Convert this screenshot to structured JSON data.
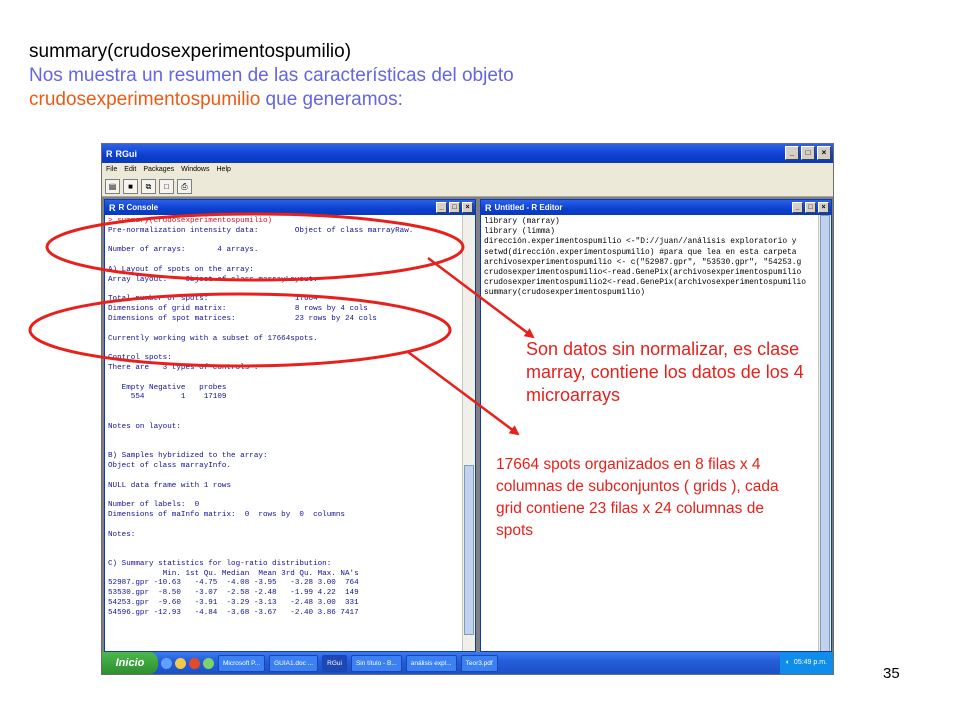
{
  "heading": {
    "line1": "summary(crudosexperimentospumilio)",
    "line2": "Nos muestra un resumen de las características del objeto",
    "line3_object": "crudosexperimentospumilio",
    "line3_rest": " que generamos:"
  },
  "rgui": {
    "title": "RGui",
    "menu": [
      "File",
      "Edit",
      "Packages",
      "Windows",
      "Help"
    ],
    "toolbar_icons": [
      "open-script-icon",
      "save-icon",
      "copy-paste-icon",
      "stop-icon",
      "print-icon"
    ]
  },
  "console": {
    "title": "R Console",
    "command": "> summary(crudosexperimentospumilio)",
    "lines": [
      "Pre-normalization intensity data:        Object of class marrayRaw.",
      "",
      "Number of arrays:       4 arrays.",
      "",
      "A) Layout of spots on the array:",
      "Array layout:    Object of class marrayLayout.",
      "",
      "Total number of spots:                   17664",
      "Dimensions of grid matrix:               8 rows by 4 cols",
      "Dimensions of spot matrices:             23 rows by 24 cols",
      "",
      "Currently working with a subset of 17664spots.",
      "",
      "Control spots:",
      "There are   3 types of controls :",
      "",
      "   Empty Negative   probes",
      "     554        1    17109",
      "",
      "",
      "Notes on layout:",
      "",
      "",
      "B) Samples hybridized to the array:",
      "Object of class marrayInfo.",
      "",
      "NULL data frame with 1 rows",
      "",
      "Number of labels:  0",
      "Dimensions of maInfo matrix:  0  rows by  0  columns",
      "",
      "Notes:",
      "",
      "",
      "C) Summary statistics for log-ratio distribution:",
      "            Min. 1st Qu. Median  Mean 3rd Qu. Max. NA's",
      "52987.gpr -10.63   -4.75  -4.08 -3.95   -3.28 3.00  764",
      "53530.gpr  -8.50   -3.07  -2.58 -2.48   -1.99 4.22  149",
      "54253.gpr  -9.60   -3.91  -3.29 -3.13   -2.48 3.00  331",
      "54596.gpr -12.93   -4.84  -3.68 -3.67   -2.40 3.86 7417"
    ]
  },
  "editor": {
    "title": "Untitled - R Editor",
    "lines": [
      "library (marray)",
      "library (limma)",
      "dirección.experimentospumilio <-\"D://juan//análisis exploratorio y",
      "setwd(dirección.experimentospumilio) #para que lea en esta carpeta",
      "archivosexperimentospumilio <- c(\"52987.gpr\", \"53530.gpr\", \"54253.g",
      "crudosexperimentospumilio<-read.GenePix(archivosexperimentospumilio",
      "crudosexperimentospumilio2<-read.GenePix(archivosexperimentospumilio",
      "summary(crudosexperimentospumilio)"
    ]
  },
  "taskbar": {
    "start_label": "Inicio",
    "tasks": [
      "Microsoft P...",
      "GUIA1.doc ...",
      "RGui",
      "Sin título - B...",
      "análisis expl...",
      "Teor3.pdf"
    ],
    "active_task": 2,
    "clock": "05:49 p.m."
  },
  "annotations": {
    "note1": "Son datos sin normalizar, es clase marray, contiene los datos de los 4 microarrays",
    "note2": "17664 spots organizados en 8 filas x 4 columnas de subconjuntos ( grids ), cada grid contiene 23 filas x 24 columnas de spots"
  },
  "colors": {
    "annotation": "#e8201c",
    "heading_blue": "#6464e6",
    "heading_orange": "#ee5a14",
    "console_text": "#10109a",
    "console_command": "#d8102a"
  },
  "page_number": "35"
}
